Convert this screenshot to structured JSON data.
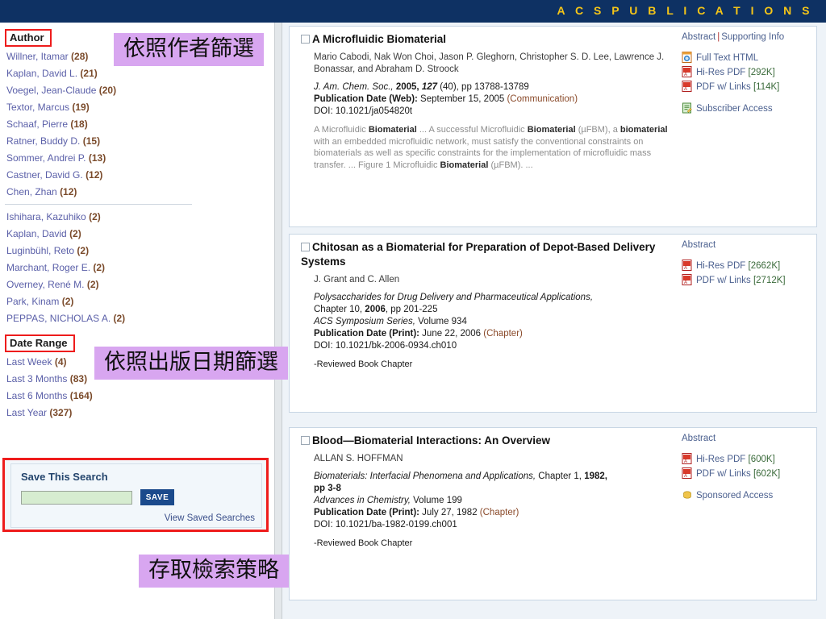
{
  "banner": {
    "title": "A C S   P U B L I C A T I O N S"
  },
  "sidebar": {
    "author_facet": {
      "heading": "Author",
      "items": [
        {
          "name": "Willner, Itamar",
          "count": "(28)"
        },
        {
          "name": "Kaplan, David L.",
          "count": "(21)"
        },
        {
          "name": "Voegel, Jean-Claude",
          "count": "(20)"
        },
        {
          "name": "Textor, Marcus",
          "count": "(19)"
        },
        {
          "name": "Schaaf, Pierre",
          "count": "(18)"
        },
        {
          "name": "Ratner, Buddy D.",
          "count": "(15)"
        },
        {
          "name": "Sommer, Andrei P.",
          "count": "(13)"
        },
        {
          "name": "Castner, David G.",
          "count": "(12)"
        },
        {
          "name": "Chen, Zhan",
          "count": "(12)"
        }
      ],
      "items_more": [
        {
          "name": "Ishihara, Kazuhiko",
          "count": "(2)"
        },
        {
          "name": "Kaplan, David",
          "count": "(2)"
        },
        {
          "name": "Luginbühl, Reto",
          "count": "(2)"
        },
        {
          "name": "Marchant, Roger E.",
          "count": "(2)"
        },
        {
          "name": "Overney, René M.",
          "count": "(2)"
        },
        {
          "name": "Park, Kinam",
          "count": "(2)"
        },
        {
          "name": "PEPPAS, NICHOLAS A.",
          "count": "(2)"
        }
      ]
    },
    "date_facet": {
      "heading": "Date Range",
      "items": [
        {
          "name": "Last Week",
          "count": "(4)"
        },
        {
          "name": "Last 3 Months",
          "count": "(83)"
        },
        {
          "name": "Last 6 Months",
          "count": "(164)"
        },
        {
          "name": "Last Year",
          "count": "(327)"
        }
      ]
    },
    "save_search": {
      "title": "Save This Search",
      "input_value": "",
      "input_placeholder": "",
      "save_label": "SAVE",
      "view_saved_label": "View Saved Searches"
    }
  },
  "results": [
    {
      "title": "A Microfluidic Biomaterial",
      "authors": "Mario Cabodi, Nak Won Choi, Jason P. Gleghorn, Christopher S. D. Lee, Lawrence J. Bonassar, and Abraham D. Stroock",
      "journal": "J. Am. Chem. Soc.,",
      "year": "2005,",
      "volume": "127",
      "issue": " (40), pp 13788-13789",
      "pub_date_label": "Publication Date (Web):",
      "pub_date_value": " September 15, 2005 ",
      "pub_type": "(Communication)",
      "doi": "DOI: 10.1021/ja054820t",
      "snippet_pre": "A Microfluidic ",
      "snippet_b1": "Biomaterial",
      "snippet_mid1": " ... A successful Microfluidic ",
      "snippet_b2": "Biomaterial",
      "snippet_mid2": " (µFBM), a ",
      "snippet_b3": "biomaterial",
      "snippet_mid3": " with an embedded microfluidic network, must satisfy the conventional constraints on biomaterials as well as specific constraints for the implementation of microfluidic mass transfer. ... Figure 1 Microfluidic ",
      "snippet_b4": "Biomaterial",
      "snippet_end": " (µFBM). ...",
      "content_type": "",
      "links": {
        "abstract": "Abstract",
        "separator": "|",
        "supporting": "Supporting Info"
      },
      "downloads": [
        {
          "icon": "html-icon",
          "label": "Full Text HTML",
          "size": ""
        },
        {
          "icon": "pdf-icon",
          "label": "Hi-Res PDF",
          "size": "[292K]"
        },
        {
          "icon": "pdf-icon",
          "label": "PDF w/ Links",
          "size": "[114K]"
        }
      ],
      "access": {
        "icon": "subscriber-icon",
        "label": "Subscriber Access"
      }
    },
    {
      "title": "Chitosan as a Biomaterial for Preparation of Depot-Based Delivery Systems",
      "authors": "J. Grant and C. Allen",
      "book": "Polysaccharides for Drug Delivery and Pharmaceutical Applications,",
      "chapter": "Chapter 10, ",
      "year": "2006",
      "pages": ", pp 201-225",
      "series": "ACS Symposium Series,",
      "series_vol": " Volume 934",
      "pub_date_label": "Publication Date (Print):",
      "pub_date_value": " June 22, 2006 ",
      "pub_type": "(Chapter)",
      "doi": "DOI: 10.1021/bk-2006-0934.ch010",
      "content_type": "-Reviewed Book Chapter",
      "links": {
        "abstract": "Abstract",
        "separator": "",
        "supporting": ""
      },
      "downloads": [
        {
          "icon": "pdf-icon",
          "label": "Hi-Res PDF",
          "size": "[2662K]"
        },
        {
          "icon": "pdf-icon",
          "label": "PDF w/ Links",
          "size": "[2712K]"
        }
      ],
      "access": {
        "icon": "",
        "label": ""
      }
    },
    {
      "title": "Blood—Biomaterial Interactions: An Overview",
      "authors": "ALLAN S. HOFFMAN",
      "book": "Biomaterials: Interfacial Phenomena and Applications,",
      "chapter": " Chapter 1, ",
      "year": "1982,",
      "pages": " pp 3-8",
      "series": "Advances in Chemistry,",
      "series_vol": " Volume 199",
      "pub_date_label": "Publication Date (Print):",
      "pub_date_value": " July 27, 1982 ",
      "pub_type": "(Chapter)",
      "doi": "DOI: 10.1021/ba-1982-0199.ch001",
      "content_type": "-Reviewed Book Chapter",
      "links": {
        "abstract": "Abstract",
        "separator": "",
        "supporting": ""
      },
      "downloads": [
        {
          "icon": "pdf-icon",
          "label": "Hi-Res PDF",
          "size": "[600K]"
        },
        {
          "icon": "pdf-icon",
          "label": "PDF w/ Links",
          "size": "[602K]"
        }
      ],
      "access": {
        "icon": "sponsored-icon",
        "label": "Sponsored Access"
      }
    }
  ],
  "annotations": {
    "author_filter": "依照作者篩選",
    "date_filter": "依照出版日期篩選",
    "save_strategy": "存取檢索策略"
  },
  "colors": {
    "banner_bg": "#0e3163",
    "banner_text": "#f5c518",
    "highlight_box": "#ee1c1c",
    "annotation_bg": "#d8a6f0",
    "link": "#4a5f8e",
    "save_button": "#1b4a8c"
  }
}
